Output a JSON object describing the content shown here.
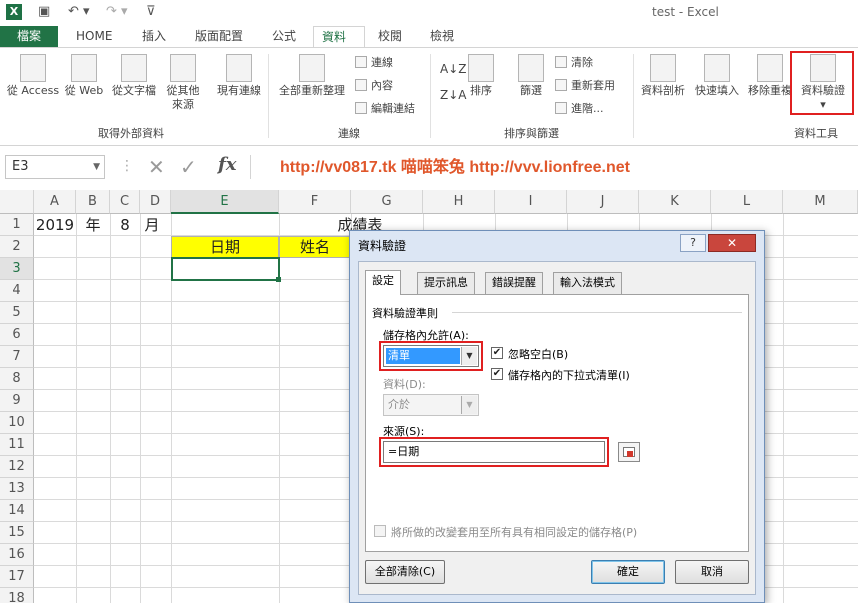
{
  "app": {
    "logo": "X",
    "title": "test - Excel",
    "qat": [
      "save-icon",
      "undo-icon",
      "redo-icon",
      "customize-icon"
    ]
  },
  "tabs": [
    "檔案",
    "HOME",
    "插入",
    "版面配置",
    "公式",
    "資料",
    "校閱",
    "檢視"
  ],
  "active_tab": "資料",
  "ribbon": {
    "external": {
      "buttons": [
        "從 Access",
        "從 Web",
        "從文字檔",
        "從其他",
        "來源",
        "現有連線"
      ],
      "group_label": "取得外部資料"
    },
    "connections": {
      "refresh_all": [
        "全部重新整理"
      ],
      "small": [
        "連線",
        "內容",
        "編輯連結"
      ],
      "group_label": "連線"
    },
    "sort_filter": {
      "sort": "排序",
      "filter": "篩選",
      "small": [
        "清除",
        "重新套用",
        "進階..."
      ],
      "group_label": "排序與篩選"
    },
    "data_tools": {
      "buttons": [
        "資料剖析",
        "快速填入",
        "移除重複",
        "資料驗證"
      ],
      "group_label": "資料工具"
    }
  },
  "formula_bar": {
    "name_box": "E3",
    "cancel_glyph": "✕",
    "enter_glyph": "✓",
    "fx": "fx",
    "watermark": "http://vv0817.tk 喵喵笨兔 http://vvv.lionfree.net"
  },
  "sheet": {
    "columns": [
      "A",
      "B",
      "C",
      "D",
      "E",
      "F",
      "G",
      "H",
      "I",
      "J",
      "K",
      "L",
      "M"
    ],
    "rows": [
      "1",
      "2",
      "3",
      "4",
      "5",
      "6",
      "7",
      "8",
      "9",
      "10",
      "11",
      "12",
      "13",
      "14",
      "15",
      "16",
      "17",
      "18"
    ],
    "selected_column": "E",
    "selected_row": "3",
    "cells": {
      "A1": "2019",
      "B1": "年",
      "C1": "8",
      "D1": "月",
      "F1": "成績表",
      "E2": "日期",
      "F2": "姓名"
    },
    "header_fill": "#ffff00"
  },
  "dialog": {
    "title": "資料驗證",
    "help": "?",
    "close": "✕",
    "tabs": [
      "設定",
      "提示訊息",
      "錯誤提醒",
      "輸入法模式"
    ],
    "section": "資料驗證準則",
    "allow_label": "儲存格內允許(A):",
    "allow_value": "清單",
    "data_label": "資料(D):",
    "data_value": "介於",
    "ignore_blank": "忽略空白(B)",
    "in_cell_dropdown": "儲存格內的下拉式清單(I)",
    "source_label": "來源(S):",
    "source_value": "=日期",
    "apply_all": "將所做的改變套用至所有具有相同設定的儲存格(P)",
    "clear_all": "全部清除(C)",
    "ok": "確定",
    "cancel": "取消",
    "highlight_color": "#e02020"
  }
}
